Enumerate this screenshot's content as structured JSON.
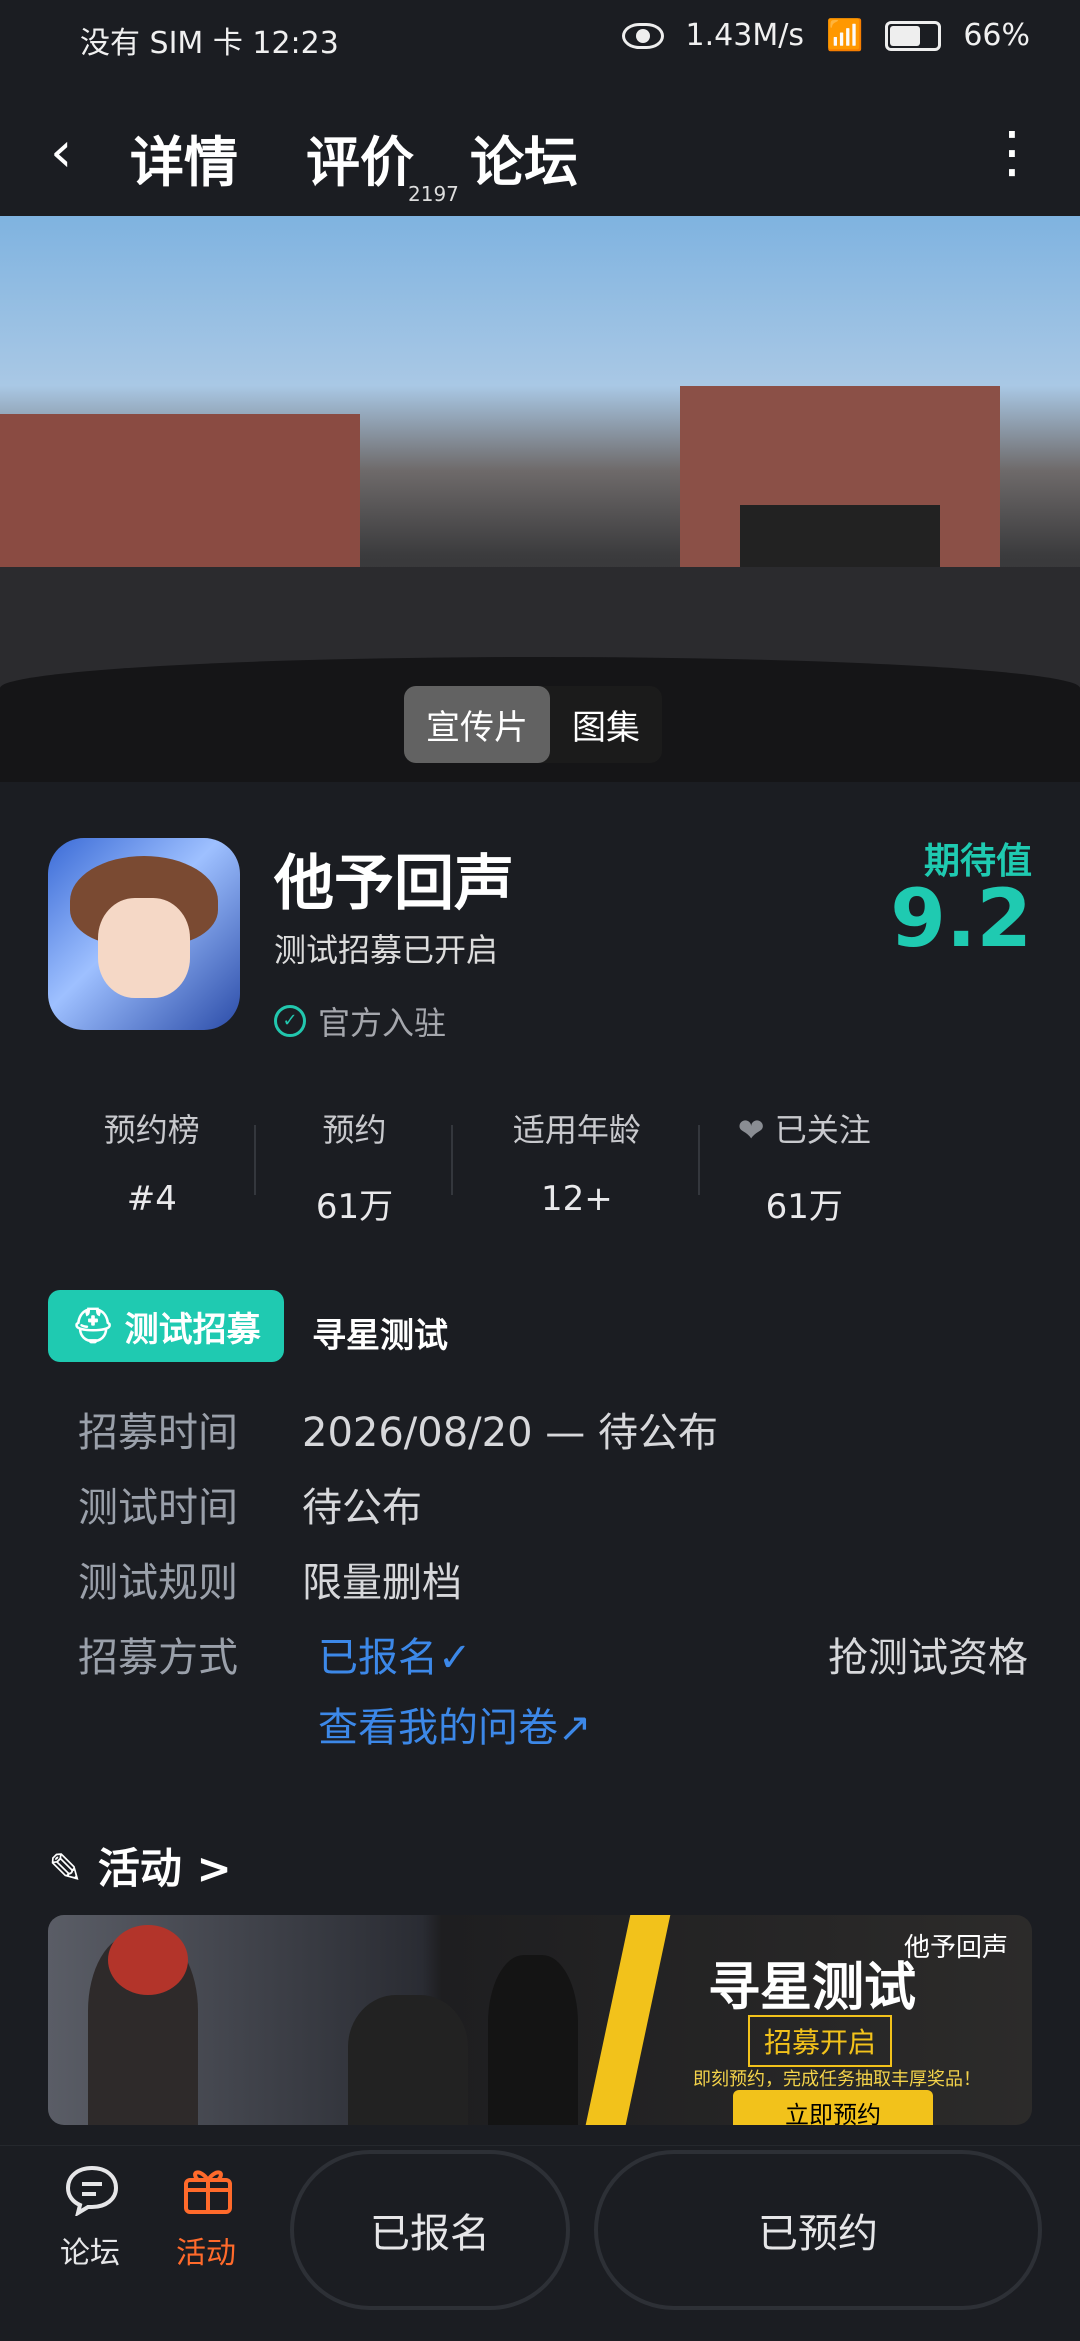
{
  "status_bar": {
    "left_text": "没有 SIM 卡 12:23",
    "speed": "1.43M/s",
    "battery": "66%"
  },
  "nav": {
    "tabs": [
      {
        "label": "详情",
        "active": true
      },
      {
        "label": "评价",
        "badge": "2197"
      },
      {
        "label": "论坛"
      }
    ]
  },
  "hero": {
    "tabs": [
      {
        "label": "宣传片",
        "active": true
      },
      {
        "label": "图集"
      }
    ]
  },
  "app": {
    "title": "他予回声",
    "subtitle": "测试招募已开启",
    "verified": "官方入驻",
    "expect_label": "期待值",
    "expect_score": "9.2"
  },
  "stats": [
    {
      "label": "预约榜",
      "value": "#4"
    },
    {
      "label": "预约",
      "value": "61万"
    },
    {
      "label": "适用年龄",
      "value": "12+"
    },
    {
      "label": "已关注",
      "value": "61万"
    }
  ],
  "recruit": {
    "chip_label": "测试招募",
    "name": "寻星测试",
    "rows": [
      {
        "label": "招募时间",
        "value": "2026/08/20 — 待公布"
      },
      {
        "label": "测试时间",
        "value": "待公布"
      },
      {
        "label": "测试规则",
        "value": "限量删档"
      },
      {
        "label": "招募方式",
        "value": ""
      }
    ],
    "signed_up": "已报名✓",
    "questionnaire": "查看我的问卷↗",
    "grab": "抢测试资格"
  },
  "activities": {
    "title": "活动 >",
    "banner": {
      "logo": "他予回声",
      "title": "寻星测试",
      "open": "招募开启",
      "note": "即刻预约，完成任务抽取丰厚奖品！",
      "button": "立即预约"
    }
  },
  "bottom": {
    "forum": "论坛",
    "activity": "活动",
    "signed_up": "已报名",
    "reserved": "已预约"
  },
  "colors": {
    "accent": "#1fcab1",
    "link": "#3c88e8",
    "orange": "#ff6a2b"
  }
}
